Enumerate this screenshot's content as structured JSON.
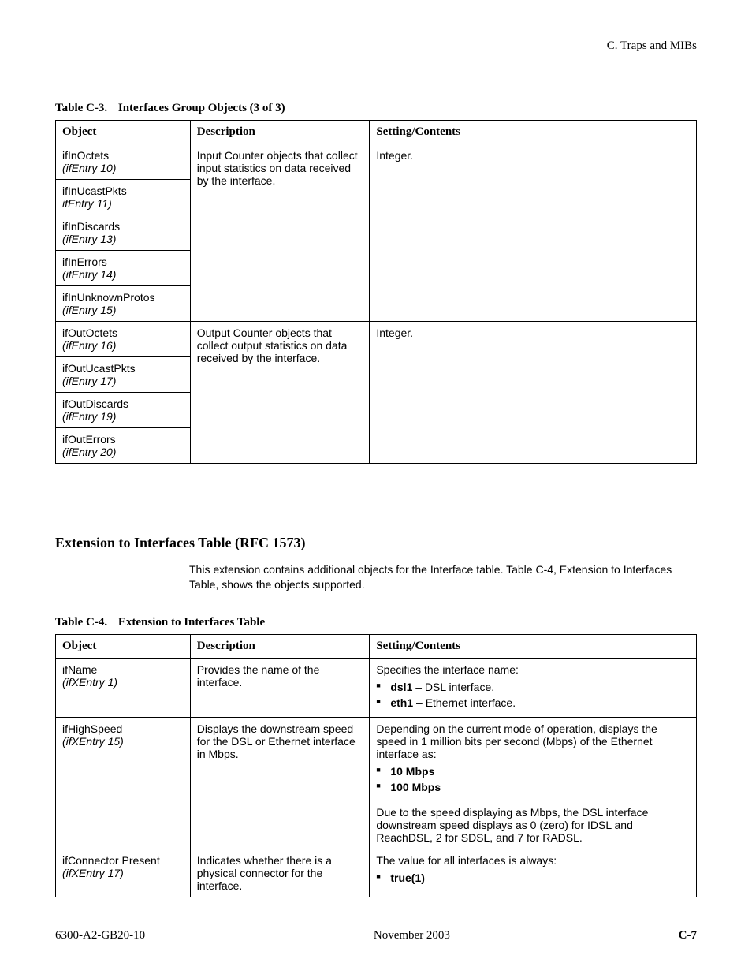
{
  "header": {
    "breadcrumb": "C. Traps and MIBs"
  },
  "tableC3": {
    "caption_label": "Table C-3.",
    "caption_title": "Interfaces Group Objects  (3 of 3)",
    "headers": {
      "c1": "Object",
      "c2": "Description",
      "c3": "Setting/Contents"
    },
    "groupA": {
      "desc": "Input Counter objects that collect input statistics on data received by the interface.",
      "setting": "Integer.",
      "rows": [
        {
          "name": "ifInOctets",
          "entry": "(ifEntry 10)"
        },
        {
          "name": "ifInUcastPkts",
          "entry": "ifEntry 11)"
        },
        {
          "name": "ifInDiscards",
          "entry": "(ifEntry 13)"
        },
        {
          "name": "ifInErrors",
          "entry": "(ifEntry 14)"
        },
        {
          "name": "ifInUnknownProtos",
          "entry": "(ifEntry 15)"
        }
      ]
    },
    "groupB": {
      "desc": "Output Counter objects that collect output statistics on data received by the interface.",
      "setting": "Integer.",
      "rows": [
        {
          "name": "ifOutOctets",
          "entry": "(ifEntry 16)"
        },
        {
          "name": "ifOutUcastPkts",
          "entry": "(ifEntry 17)"
        },
        {
          "name": "ifOutDiscards",
          "entry": "(ifEntry 19)"
        },
        {
          "name": "ifOutErrors",
          "entry": "(ifEntry 20)"
        }
      ]
    }
  },
  "section": {
    "heading": "Extension to Interfaces Table (RFC 1573)",
    "intro": "This extension contains additional objects for the Interface table. Table C-4, Extension to Interfaces Table, shows the objects supported."
  },
  "tableC4": {
    "caption_label": "Table C-4.",
    "caption_title": "Extension to Interfaces Table",
    "headers": {
      "c1": "Object",
      "c2": "Description",
      "c3": "Setting/Contents"
    },
    "row1": {
      "name": "ifName",
      "entry": "(ifXEntry 1)",
      "desc": "Provides the name of the interface.",
      "setting_lead": "Specifies the interface name:",
      "b1_bold": "dsl1",
      "b1_rest": " – DSL interface.",
      "b2_bold": "eth1",
      "b2_rest": " – Ethernet interface."
    },
    "row2": {
      "name": "ifHighSpeed",
      "entry": "(ifXEntry 15)",
      "desc": "Displays the downstream speed for the DSL or Ethernet interface in Mbps.",
      "setting_lead": "Depending on the current mode of operation, displays the speed in 1 million bits per second (Mbps) of the Ethernet interface as:",
      "b1": "10 Mbps",
      "b2": "100 Mbps",
      "setting_tail": "Due to the speed displaying as Mbps, the DSL interface downstream speed displays as 0 (zero) for IDSL and ReachDSL, 2 for SDSL, and 7 for RADSL."
    },
    "row3": {
      "name": "ifConnector Present",
      "entry": "(ifXEntry 17)",
      "desc": "Indicates whether there is a physical connector for the interface.",
      "setting_lead": "The value for all interfaces is always:",
      "b1": "true(1)"
    }
  },
  "footer": {
    "left": "6300-A2-GB20-10",
    "center": "November 2003",
    "right": "C-7"
  }
}
